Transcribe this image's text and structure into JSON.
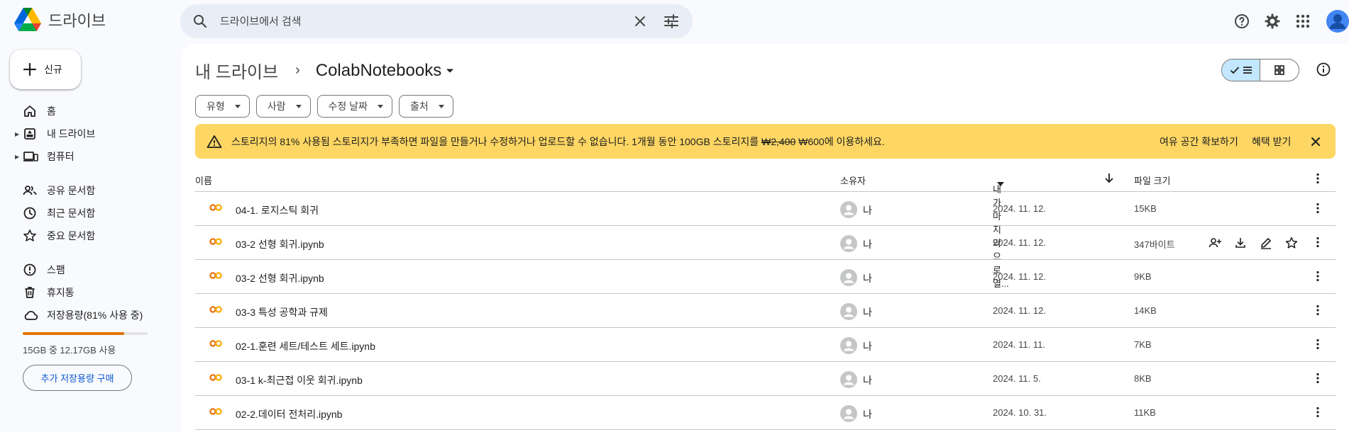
{
  "app": {
    "title": "드라이브"
  },
  "search": {
    "placeholder": "드라이브에서 검색"
  },
  "sidebar": {
    "new_label": "신규",
    "items": [
      {
        "label": "홈",
        "icon": "home-icon"
      },
      {
        "label": "내 드라이브",
        "icon": "my-drive-icon"
      },
      {
        "label": "컴퓨터",
        "icon": "computer-icon"
      },
      {
        "label": "공유 문서함",
        "icon": "shared-icon"
      },
      {
        "label": "최근 문서함",
        "icon": "clock-icon"
      },
      {
        "label": "중요 문서함",
        "icon": "star-icon"
      },
      {
        "label": "스팸",
        "icon": "spam-icon"
      },
      {
        "label": "휴지통",
        "icon": "trash-icon"
      },
      {
        "label": "저장용량(81% 사용 중)",
        "icon": "cloud-icon"
      }
    ],
    "storage_used_fraction": 0.81,
    "storage_text": "15GB 중 12.17GB 사용",
    "buy_label": "추가 저장용량 구매"
  },
  "breadcrumb": {
    "root": "내 드라이브",
    "current": "ColabNotebooks"
  },
  "filters": [
    "유형",
    "사람",
    "수정 날짜",
    "출처"
  ],
  "banner": {
    "bold": "스토리지의 81% 사용됨",
    "text_before_price": " 스토리지가 부족하면 파일을 만들거나 수정하거나 업로드할 수 없습니다. 1개월 동안 100GB 스토리지를 ",
    "old_price": "₩2,400",
    "text_after_price": " ₩600에 이용하세요.",
    "action_free_space": "여유 공간 확보하기",
    "action_get_offer": "혜택 받기"
  },
  "table": {
    "headers": {
      "name": "이름",
      "owner": "소유자",
      "opened": "내가 마지막으로 열...",
      "size": "파일 크기"
    },
    "rows": [
      {
        "name": "04-1. 로지스틱 회귀",
        "owner": "나",
        "date": "2024. 11. 12.",
        "size": "15KB",
        "hover": false
      },
      {
        "name": "03-2 선형 회귀.ipynb",
        "owner": "나",
        "date": "2024. 11. 12.",
        "size": "347바이트",
        "hover": true
      },
      {
        "name": "03-2 선형 회귀.ipynb",
        "owner": "나",
        "date": "2024. 11. 12.",
        "size": "9KB",
        "hover": false
      },
      {
        "name": "03-3 특성 공학과 규제",
        "owner": "나",
        "date": "2024. 11. 12.",
        "size": "14KB",
        "hover": false
      },
      {
        "name": "02-1.훈련 세트/테스트 세트.ipynb",
        "owner": "나",
        "date": "2024. 11. 11.",
        "size": "7KB",
        "hover": false
      },
      {
        "name": "03-1 k-최근접 이웃 회귀.ipynb",
        "owner": "나",
        "date": "2024. 11. 5.",
        "size": "8KB",
        "hover": false
      },
      {
        "name": "02-2.데이터 전처리.ipynb",
        "owner": "나",
        "date": "2024. 10. 31.",
        "size": "11KB",
        "hover": false
      }
    ]
  },
  "colors": {
    "accent": "#0b57d0",
    "banner": "#fdd663",
    "storage": "#e37400",
    "colab": "#f9ab00"
  }
}
